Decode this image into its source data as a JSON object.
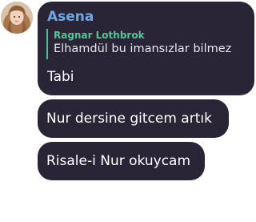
{
  "message_group": {
    "sender": {
      "name": "Asena",
      "name_color": "#6aa8e8",
      "avatar_icon": "user-avatar-photo"
    },
    "reply": {
      "author": "Ragnar Lothbrok",
      "text": "Elhamdül bu imansızlar bilmez",
      "accent_color": "#4cbf8f"
    },
    "messages": [
      {
        "text": "Tabi"
      },
      {
        "text": "Nur dersine gitcem artık"
      },
      {
        "text": "Risale-i Nur okuycam"
      }
    ],
    "bubble_color": "#2a2536"
  }
}
